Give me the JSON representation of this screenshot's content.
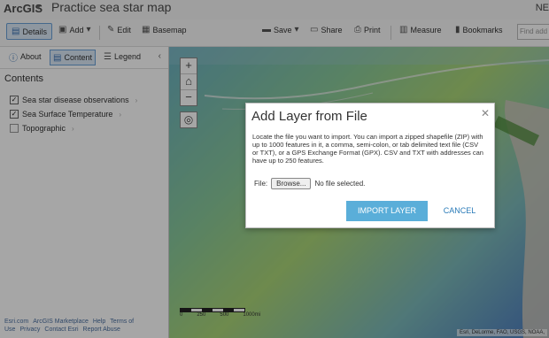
{
  "app": {
    "brand": "ArcGIS",
    "title": "Practice sea star map",
    "user": "NE"
  },
  "toolbar": {
    "details": "Details",
    "add": "Add",
    "edit": "Edit",
    "basemap": "Basemap",
    "save": "Save",
    "share": "Share",
    "print": "Print",
    "measure": "Measure",
    "bookmarks": "Bookmarks",
    "find_placeholder": "Find add"
  },
  "sidebar": {
    "tabs": [
      "About",
      "Content",
      "Legend"
    ],
    "heading": "Contents",
    "layers": [
      {
        "label": "Sea star disease observations",
        "checked": true
      },
      {
        "label": "Sea Surface Temperature",
        "checked": true
      },
      {
        "label": "Topographic",
        "checked": false
      }
    ],
    "footer_links": [
      "Esri.com",
      "ArcGIS Marketplace",
      "Help",
      "Terms of Use",
      "Privacy",
      "Contact Esri",
      "Report Abuse"
    ]
  },
  "map": {
    "scale_labels": [
      "0",
      "250",
      "500",
      "1000mi"
    ],
    "attribution": "Esri, DeLorme, FAO, USGS, NOAA,"
  },
  "dialog": {
    "title": "Add Layer from File",
    "body": "Locate the file you want to import. You can import a zipped shapefile (ZIP) with up to 1000 features in it, a comma, semi-colon, or tab delimited text file (CSV or TXT), or a GPS Exchange Format (GPX). CSV and TXT with addresses can have up to 250 features.",
    "file_label": "File:",
    "browse_label": "Browse...",
    "file_status": "No file selected.",
    "import_label": "IMPORT LAYER",
    "cancel_label": "CANCEL"
  }
}
